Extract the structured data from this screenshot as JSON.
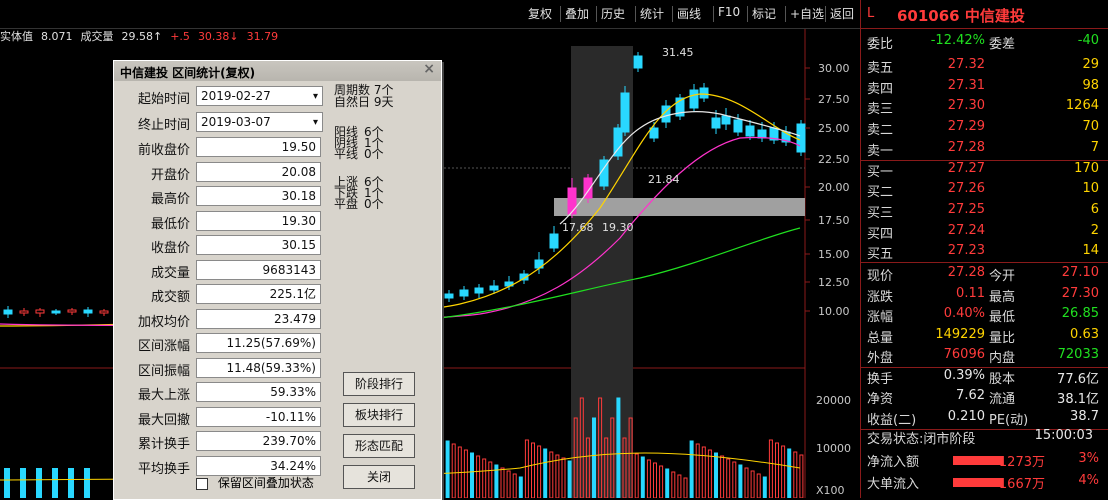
{
  "toolbar": {
    "items": [
      "复权",
      "叠加",
      "历史",
      "统计",
      "画线",
      "F10",
      "标记",
      "+自选",
      "返回"
    ]
  },
  "indicator": {
    "items": [
      {
        "text": "实体值",
        "color": "#e0e0e0"
      },
      {
        "text": "8.071",
        "color": "#e0e0e0"
      },
      {
        "text": "成交量",
        "color": "#e0e0e0"
      },
      {
        "text": "29.58↑",
        "color": "#e0e0e0"
      },
      {
        "text": "+.5",
        "color": "#ff3b3b"
      },
      {
        "text": "30.38↓",
        "color": "#ff3b3b"
      },
      {
        "text": "31.79",
        "color": "#ff3b3b"
      }
    ]
  },
  "chart": {
    "price_axis": [
      "30.00",
      "27.50",
      "25.00",
      "22.50",
      "20.00",
      "17.50",
      "15.00",
      "12.50",
      "10.00"
    ],
    "vol_axis": [
      "20000",
      "10000",
      "X100"
    ],
    "annotation_high": "31.45",
    "annotation_mid": "21.84",
    "annotation_low": "17.68",
    "annotation_low2": "19.30"
  },
  "dialog": {
    "title": "中信建投 区间统计(复权)",
    "start_label": "起始时间",
    "start_value": "2019-02-27",
    "end_label": "终止时间",
    "end_value": "2019-03-07",
    "rows": [
      {
        "label": "前收盘价",
        "value": "19.50"
      },
      {
        "label": "开盘价",
        "value": "20.08"
      },
      {
        "label": "最高价",
        "value": "30.18"
      },
      {
        "label": "最低价",
        "value": "19.30"
      },
      {
        "label": "收盘价",
        "value": "30.15"
      },
      {
        "label": "成交量",
        "value": "9683143"
      },
      {
        "label": "成交额",
        "value": "225.1亿"
      },
      {
        "label": "加权均价",
        "value": "23.479"
      },
      {
        "label": "区间涨幅",
        "value": "11.25(57.69%)"
      },
      {
        "label": "区间振幅",
        "value": "11.48(59.33%)"
      },
      {
        "label": "最大上涨",
        "value": "59.33%"
      },
      {
        "label": "最大回撤",
        "value": "-10.11%"
      },
      {
        "label": "累计换手",
        "value": "239.70%"
      },
      {
        "label": "平均换手",
        "value": "34.24%"
      }
    ],
    "period_label_a": "周期数",
    "period_value_a": "7个",
    "period_label_b": "自然日",
    "period_value_b": "9天",
    "stats": [
      {
        "label": "阳线",
        "value": "6个"
      },
      {
        "label": "阴线",
        "value": "1个"
      },
      {
        "label": "平线",
        "value": "0个"
      },
      {
        "label": "上涨",
        "value": "6个"
      },
      {
        "label": "下跌",
        "value": "1个"
      },
      {
        "label": "平盘",
        "value": "0个"
      }
    ],
    "buttons": [
      "阶段排行",
      "板块排行",
      "形态匹配",
      "关闭"
    ],
    "checkbox_label": "保留区间叠加状态"
  },
  "quote": {
    "flag": "L",
    "code_name": "601066 中信建投",
    "weibi_label": "委比",
    "weibi_value": "-12.42%",
    "weicha_label": "委差",
    "weicha_value": "-40",
    "asks": [
      {
        "label": "卖五",
        "price": "27.32",
        "vol": "29"
      },
      {
        "label": "卖四",
        "price": "27.31",
        "vol": "98"
      },
      {
        "label": "卖三",
        "price": "27.30",
        "vol": "1264"
      },
      {
        "label": "卖二",
        "price": "27.29",
        "vol": "70"
      },
      {
        "label": "卖一",
        "price": "27.28",
        "vol": "7"
      }
    ],
    "bids": [
      {
        "label": "买一",
        "price": "27.27",
        "vol": "170"
      },
      {
        "label": "买二",
        "price": "27.26",
        "vol": "10"
      },
      {
        "label": "买三",
        "price": "27.25",
        "vol": "6"
      },
      {
        "label": "买四",
        "price": "27.24",
        "vol": "2"
      },
      {
        "label": "买五",
        "price": "27.23",
        "vol": "14"
      }
    ],
    "stats": [
      {
        "l1": "现价",
        "v1": "27.28",
        "l2": "今开",
        "v2": "27.10",
        "c1": "#ff3b3b",
        "c2": "#ff3b3b"
      },
      {
        "l1": "涨跌",
        "v1": "0.11",
        "l2": "最高",
        "v2": "27.30",
        "c1": "#ff3b3b",
        "c2": "#ff3b3b"
      },
      {
        "l1": "涨幅",
        "v1": "0.40%",
        "l2": "最低",
        "v2": "26.85",
        "c1": "#ff3b3b",
        "c2": "#20e020"
      },
      {
        "l1": "总量",
        "v1": "149229",
        "l2": "量比",
        "v2": "0.63",
        "c1": "#ffd400",
        "c2": "#ffd400"
      },
      {
        "l1": "外盘",
        "v1": "76096",
        "l2": "内盘",
        "v2": "72033",
        "c1": "#ff3b3b",
        "c2": "#20e020"
      },
      {
        "l1": "换手",
        "v1": "0.39%",
        "l2": "股本",
        "v2": "77.6亿",
        "c1": "#e8e8e8",
        "c2": "#e8e8e8"
      },
      {
        "l1": "净资",
        "v1": "7.62",
        "l2": "流通",
        "v2": "38.1亿",
        "c1": "#e8e8e8",
        "c2": "#e8e8e8"
      },
      {
        "l1": "收益(二)",
        "v1": "0.210",
        "l2": "PE(动)",
        "v2": "38.7",
        "c1": "#e8e8e8",
        "c2": "#e8e8e8"
      }
    ],
    "trade_status_label": "交易状态:闭市阶段",
    "trade_status_time": "15:00:03",
    "flow": [
      {
        "label": "净流入额",
        "value": "1273万",
        "pct": "3%"
      },
      {
        "label": "大单流入",
        "value": "1667万",
        "pct": "4%"
      }
    ]
  }
}
